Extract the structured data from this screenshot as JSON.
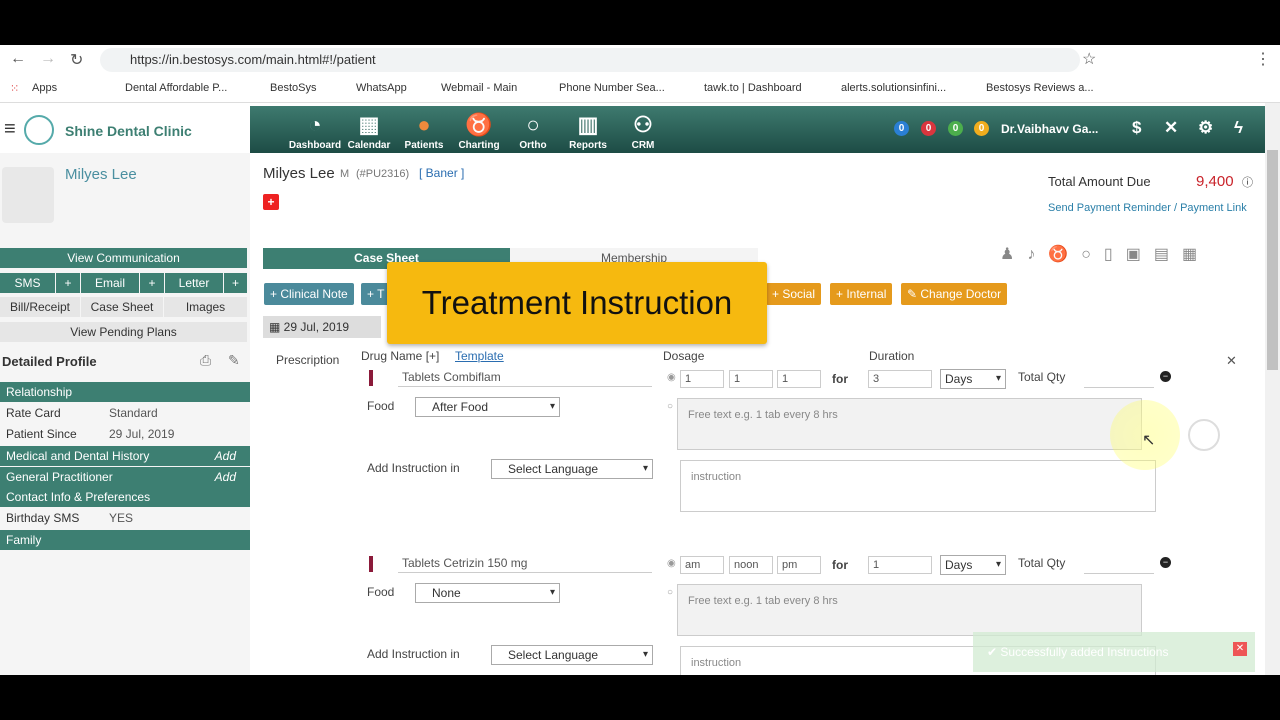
{
  "browser": {
    "url": "https://in.bestosys.com/main.html#!/patient",
    "bookmarks": [
      "Apps",
      "Dental Affordable P...",
      "BestoSys",
      "WhatsApp",
      "Webmail - Main",
      "Phone Number Sea...",
      "tawk.to | Dashboard",
      "alerts.solutionsinfini...",
      "Bestosys Reviews a..."
    ]
  },
  "clinic": {
    "name": "Shine Dental Clinic"
  },
  "nav": [
    "Dashboard",
    "Calendar",
    "Patients",
    "Charting",
    "Ortho",
    "Reports",
    "CRM"
  ],
  "badges": [
    {
      "value": "0",
      "color": "#2a7fd4"
    },
    {
      "value": "0",
      "color": "#d9363e"
    },
    {
      "value": "0",
      "color": "#4cae4c"
    },
    {
      "value": "0",
      "color": "#f0ad1e"
    }
  ],
  "user": {
    "name": "Dr.Vaibhavv Ga..."
  },
  "patient": {
    "name": "Milyes Lee",
    "gender": "M",
    "id": "(#PU2316)",
    "tag": "[ Baner ]"
  },
  "billing": {
    "label": "Total Amount Due",
    "amount": "9,400",
    "link": "Send Payment Reminder / Payment Link"
  },
  "sidebar": {
    "view_communication": "View Communication",
    "sms": "SMS",
    "email": "Email",
    "letter": "Letter",
    "plus": "+",
    "bill": "Bill/Receipt",
    "case_sheet": "Case Sheet",
    "images": "Images",
    "pending": "View Pending Plans",
    "profile_title": "Detailed Profile",
    "rows": [
      {
        "label": "Relationship",
        "teal": true
      },
      {
        "label": "Rate Card",
        "value": "Standard"
      },
      {
        "label": "Patient Since",
        "value": "29 Jul, 2019"
      },
      {
        "label": "Medical and Dental History",
        "action": "Add",
        "teal": true
      },
      {
        "label": "General Practitioner",
        "action": "Add",
        "teal": true
      },
      {
        "label": "Contact Info & Preferences",
        "teal": true
      },
      {
        "label": "Birthday SMS",
        "value": "YES"
      },
      {
        "label": "Family",
        "teal": true
      }
    ]
  },
  "tabs": {
    "case_sheet": "Case Sheet",
    "membership": "Membership"
  },
  "actions": {
    "clinical_note": "+ Clinical Note",
    "treatment": "+ T",
    "social": "+ Social",
    "internal": "+ Internal",
    "change_doctor": "Change Doctor"
  },
  "date": "29 Jul, 2019",
  "overlay": "Treatment Instruction",
  "prescription": {
    "label": "Prescription",
    "drug_name": "Drug Name [+]",
    "template": "Template",
    "dosage": "Dosage",
    "duration": "Duration",
    "total_qty": "Total Qty",
    "for": "for",
    "food": "Food",
    "add_instruction": "Add Instruction in",
    "select_language": "Select Language",
    "free_text_placeholder": "Free text e.g. 1 tab every 8 hrs",
    "instruction_placeholder": "instruction",
    "items": [
      {
        "drug": "Tablets Combiflam",
        "dose": [
          "1",
          "1",
          "1"
        ],
        "duration": "3",
        "unit": "Days",
        "food": "After Food"
      },
      {
        "drug": "Tablets Cetrizin 150 mg",
        "dose": [
          "am",
          "noon",
          "pm"
        ],
        "duration": "1",
        "unit": "Days",
        "food": "None"
      }
    ]
  },
  "toast": "Successfully added Instructions"
}
